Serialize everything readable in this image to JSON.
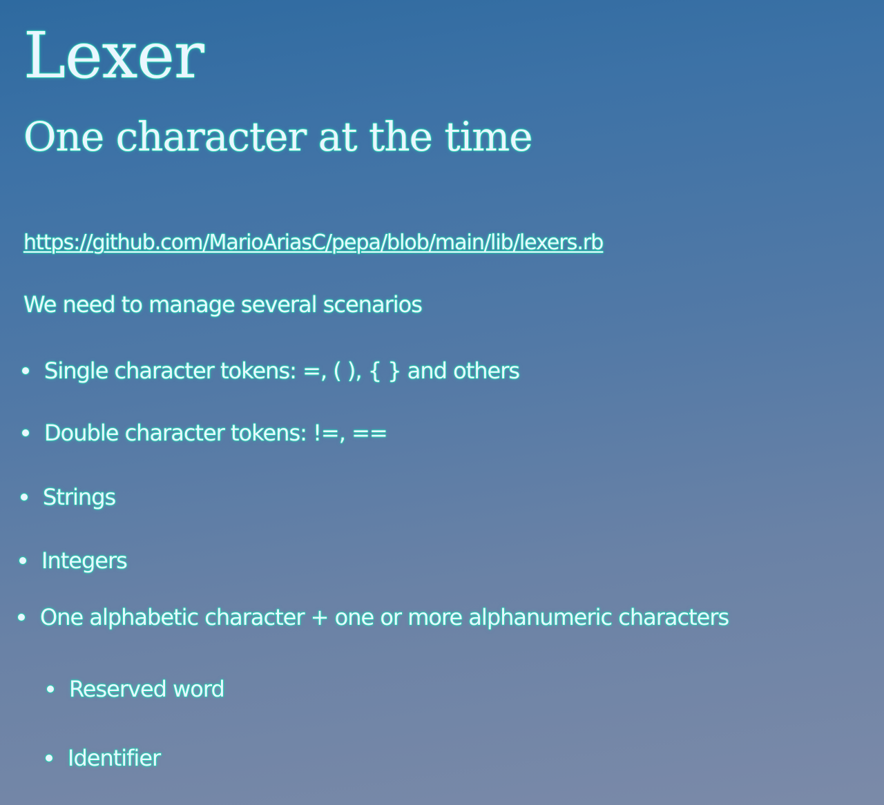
{
  "slide": {
    "title": "Lexer",
    "subtitle": "One character at the time",
    "link": "https://github.com/MarioAriasC/pepa/blob/main/lib/lexers.rb",
    "intro": "We need to manage several scenarios",
    "bullets": [
      "Single character tokens: =, ( ), { } and others",
      "Double character tokens: !=, ==",
      "Strings",
      "Integers",
      "One alphabetic character + one or more alphanumeric characters"
    ],
    "sub_bullets": [
      "Reserved word",
      "Identifier"
    ]
  },
  "colors": {
    "background_top": "#2e6aa0",
    "background_bottom": "#7b8aa8",
    "text": "#eaf6ff",
    "outline": "#27c9ad"
  }
}
